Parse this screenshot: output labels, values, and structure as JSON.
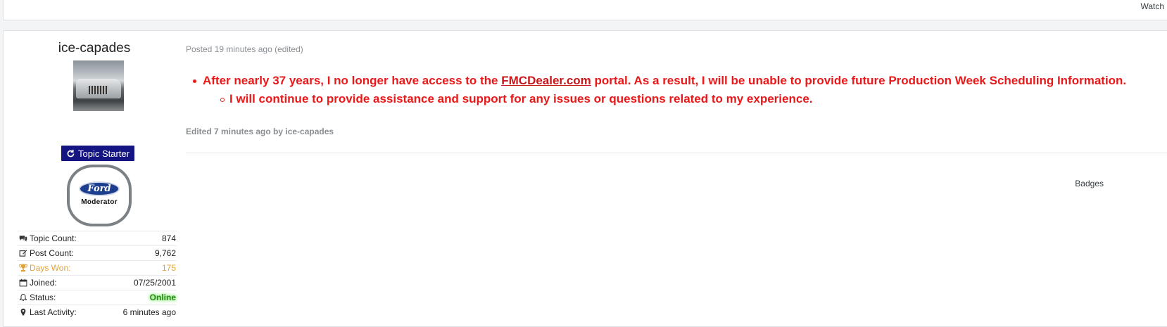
{
  "previous_post": {
    "watch_label": "Watch"
  },
  "author": {
    "name": "ice-capades",
    "topic_starter_label": "Topic Starter",
    "badge": {
      "logo_text": "Ford",
      "label": "Moderator"
    },
    "stats": [
      {
        "icon": "comments-icon",
        "label": "Topic Count:",
        "value": "874"
      },
      {
        "icon": "edit-icon",
        "label": "Post Count:",
        "value": "9,762"
      },
      {
        "icon": "trophy-icon",
        "label": "Days Won:",
        "value": "175"
      },
      {
        "icon": "calendar-icon",
        "label": "Joined:",
        "value": "07/25/2001"
      },
      {
        "icon": "bell-icon",
        "label": "Status:",
        "value": "Online"
      },
      {
        "icon": "map-marker-icon",
        "label": "Last Activity:",
        "value": "6 minutes ago"
      }
    ]
  },
  "post": {
    "meta": "Posted 19 minutes ago (edited)",
    "bullet1_pre": "After nearly 37 years, I no longer have access to the ",
    "bullet1_link": "FMCDealer.com",
    "bullet1_post": " portal. As a result, I will be unable to provide future Production Week Scheduling Information.",
    "bullet2": "I will continue to provide assistance and support for any issues or questions related to my experience.",
    "edited_note": "Edited 7 minutes ago by ice-capades",
    "badges_label": "Badges"
  },
  "colors": {
    "topic_starter_bg": "#141582",
    "content_red": "#ea1919",
    "days_won": "#e0a33a",
    "online_green": "#2a8a17"
  }
}
